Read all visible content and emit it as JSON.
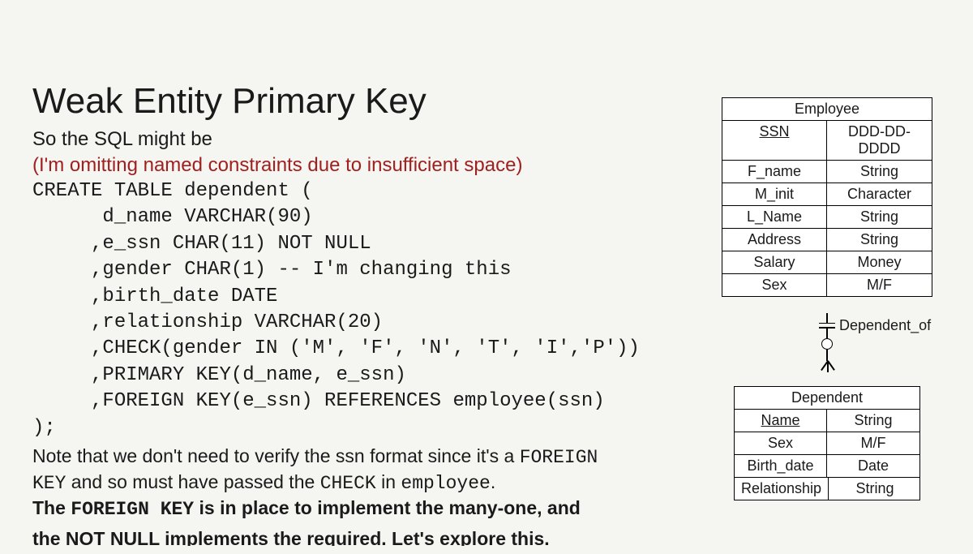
{
  "title": "Weak Entity Primary Key",
  "subtitle": "So the SQL might be",
  "omit": "(I'm omitting named constraints due to insufficient space)",
  "code": {
    "l1": "CREATE TABLE dependent (",
    "l2": "      d_name VARCHAR(90)",
    "l3": "     ,e_ssn CHAR(11) NOT NULL",
    "l4": "     ,gender CHAR(1) -- I'm changing this",
    "l5": "     ,birth_date DATE",
    "l6": "     ,relationship VARCHAR(20)",
    "l7": "     ,CHECK(gender IN ('M', 'F', 'N', 'T', 'I','P'))",
    "l8": "     ,PRIMARY KEY(d_name, e_ssn)",
    "l9": "     ,FOREIGN KEY(e_ssn) REFERENCES employee(ssn)",
    "l10": ");"
  },
  "note": {
    "text1": "Note that we don't need to verify the ssn format since it's a ",
    "fk": "FOREIGN KEY",
    "text2": " and so must have passed the ",
    "check": "CHECK",
    "text3": " in ",
    "emp": "employee",
    "text4": ".",
    "text5_a": "The ",
    "text5_b": " is in place to implement the many-one, and"
  },
  "cutoff": "the NOT NULL implements the required. Let's explore this.",
  "er": {
    "employee": {
      "name": "Employee",
      "attrs": [
        {
          "name": "SSN",
          "type": "DDD-DD-DDDD",
          "pk": true
        },
        {
          "name": "F_name",
          "type": "String"
        },
        {
          "name": "M_init",
          "type": "Character"
        },
        {
          "name": "L_Name",
          "type": "String"
        },
        {
          "name": "Address",
          "type": "String"
        },
        {
          "name": "Salary",
          "type": "Money"
        },
        {
          "name": "Sex",
          "type": "M/F"
        }
      ]
    },
    "rel": "Dependent_of",
    "dependent": {
      "name": "Dependent",
      "attrs": [
        {
          "name": "Name",
          "type": "String",
          "pk": true
        },
        {
          "name": "Sex",
          "type": "M/F"
        },
        {
          "name": "Birth_date",
          "type": "Date"
        },
        {
          "name": "Relationship",
          "type": "String"
        }
      ]
    }
  }
}
